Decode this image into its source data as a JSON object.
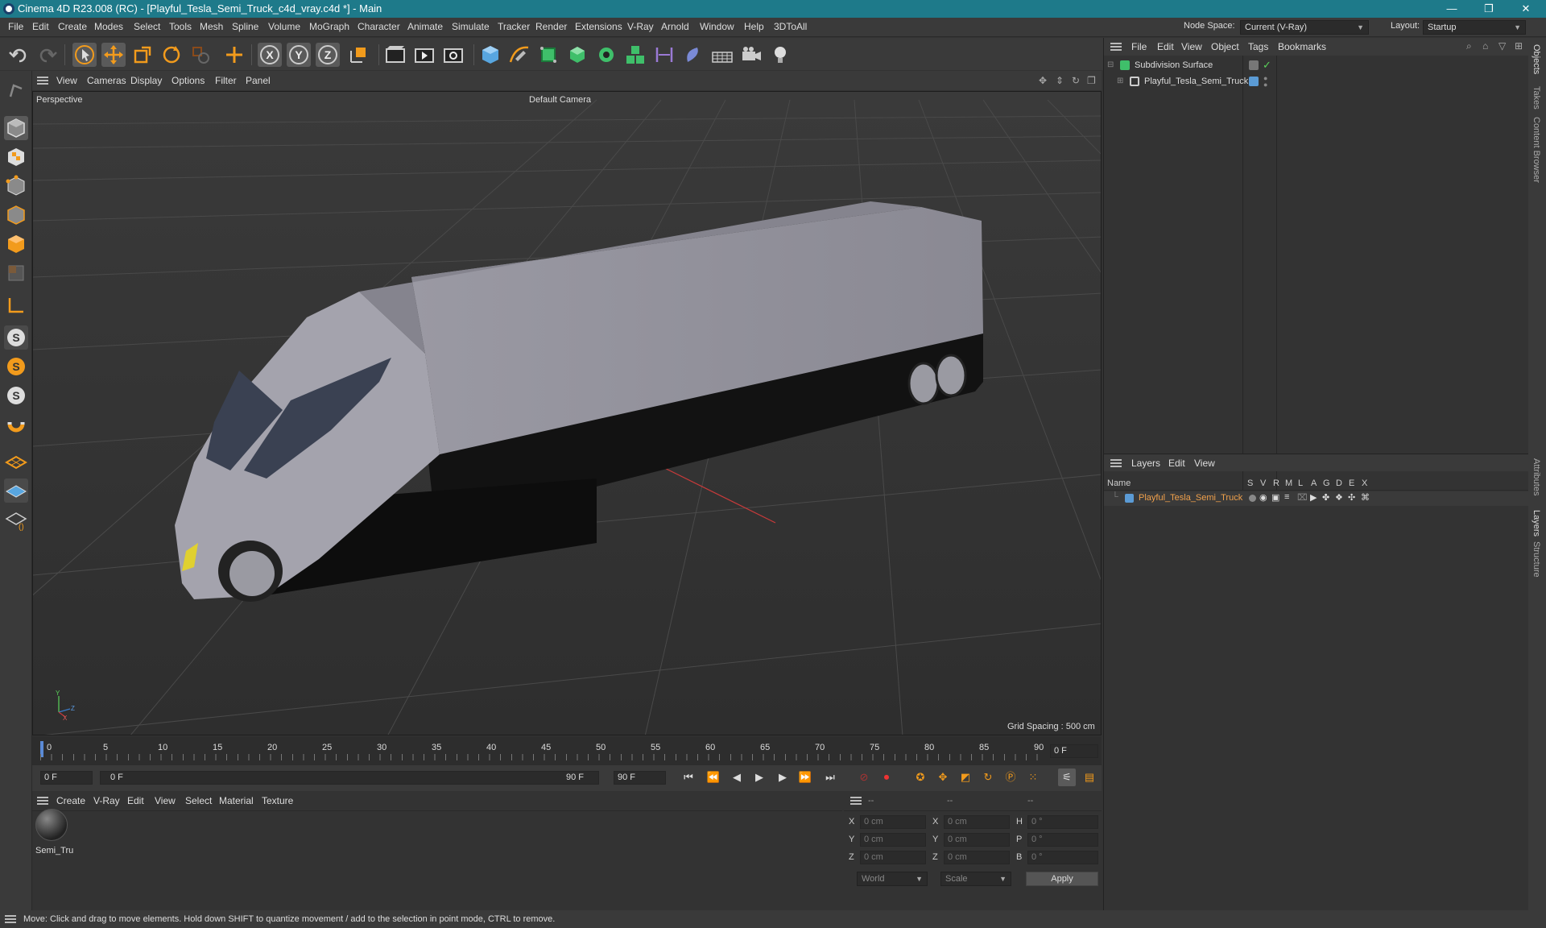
{
  "app": {
    "title": "Cinema 4D R23.008 (RC) - [Playful_Tesla_Semi_Truck_c4d_vray.c4d *] - Main",
    "icon": "cinema4d-logo-icon"
  },
  "menubar": {
    "items": [
      "File",
      "Edit",
      "Create",
      "Modes",
      "Select",
      "Tools",
      "Mesh",
      "Spline",
      "Volume",
      "MoGraph",
      "Character",
      "Animate",
      "Simulate",
      "Tracker",
      "Render",
      "Extensions",
      "V-Ray",
      "Arnold",
      "Window",
      "Help",
      "3DToAll"
    ],
    "node_space_label": "Node Space:",
    "node_space_value": "Current (V-Ray)",
    "layout_label": "Layout:",
    "layout_value": "Startup"
  },
  "toolbar": {
    "icons": [
      "undo-icon",
      "redo-icon",
      "select-pointer-icon",
      "move-icon",
      "scale-icon",
      "rotate-icon",
      "recent-tool-icon",
      "add-icon",
      "x-axis-icon",
      "y-axis-icon",
      "z-axis-icon",
      "coordinate-system-icon",
      "render-region-icon",
      "render-view-icon",
      "render-settings-icon",
      "cube-primitive-icon",
      "pen-spline-icon",
      "subdivision-icon",
      "extrude-icon",
      "cloner-icon",
      "mograph-icon",
      "symmetry-icon",
      "deformer-icon",
      "floor-icon",
      "camera-icon",
      "light-icon"
    ],
    "axis_labels": [
      "X",
      "Y",
      "Z"
    ]
  },
  "viewport": {
    "menu": [
      "View",
      "Cameras",
      "Display",
      "Options",
      "Filter",
      "Panel"
    ],
    "projection": "Perspective",
    "camera": "Default Camera",
    "grid_spacing": "Grid Spacing : 500 cm",
    "axis_labels": {
      "x": "X",
      "y": "Y",
      "z": "Z"
    }
  },
  "timeline": {
    "ticks": [
      "0",
      "5",
      "10",
      "15",
      "20",
      "25",
      "30",
      "35",
      "40",
      "45",
      "50",
      "55",
      "60",
      "65",
      "70",
      "75",
      "80",
      "85",
      "90"
    ],
    "current_frame_display": "0 F"
  },
  "transport": {
    "start_frame": "0 F",
    "range_start": "0 F",
    "range_end": "90 F",
    "end_frame": "90 F"
  },
  "material_panel": {
    "menu": [
      "Create",
      "V-Ray",
      "Edit",
      "View",
      "Select",
      "Material",
      "Texture"
    ],
    "materials": [
      {
        "name": "Semi_Tru"
      }
    ]
  },
  "coordinates": {
    "header": [
      "--",
      "--",
      "--"
    ],
    "rows": [
      {
        "a_label": "X",
        "a_val": "0 cm",
        "b_label": "X",
        "b_val": "0 cm",
        "c_label": "H",
        "c_val": "0 °"
      },
      {
        "a_label": "Y",
        "a_val": "0 cm",
        "b_label": "Y",
        "b_val": "0 cm",
        "c_label": "P",
        "c_val": "0 °"
      },
      {
        "a_label": "Z",
        "a_val": "0 cm",
        "b_label": "Z",
        "b_val": "0 cm",
        "c_label": "B",
        "c_val": "0 °"
      }
    ],
    "world_select": "World",
    "scale_select": "Scale",
    "apply_label": "Apply"
  },
  "objects_panel": {
    "menu": [
      "File",
      "Edit",
      "View",
      "Object",
      "Tags",
      "Bookmarks"
    ],
    "tree": [
      {
        "name": "Subdivision Surface",
        "icon": "subdivision-icon"
      },
      {
        "name": "Playful_Tesla_Semi_Truck",
        "icon": "null-object-icon"
      }
    ]
  },
  "layers_panel": {
    "menu": [
      "Layers",
      "Edit",
      "View"
    ],
    "columns": [
      "Name",
      "S",
      "V",
      "R",
      "M",
      "L",
      "A",
      "G",
      "D",
      "E",
      "X"
    ],
    "rows": [
      {
        "name": "Playful_Tesla_Semi_Truck",
        "color": "#5b9bd5"
      }
    ]
  },
  "side_tabs": [
    "Objects",
    "Takes",
    "Content Browser",
    "Attributes",
    "Layers",
    "Structure"
  ],
  "status": {
    "text": "Move: Click and drag to move elements. Hold down SHIFT to quantize movement / add to the selection in point mode, CTRL to remove."
  },
  "colors": {
    "titlebar": "#1e7a8a",
    "accent_orange": "#f29b1c",
    "layer_name": "#f0a04b"
  }
}
